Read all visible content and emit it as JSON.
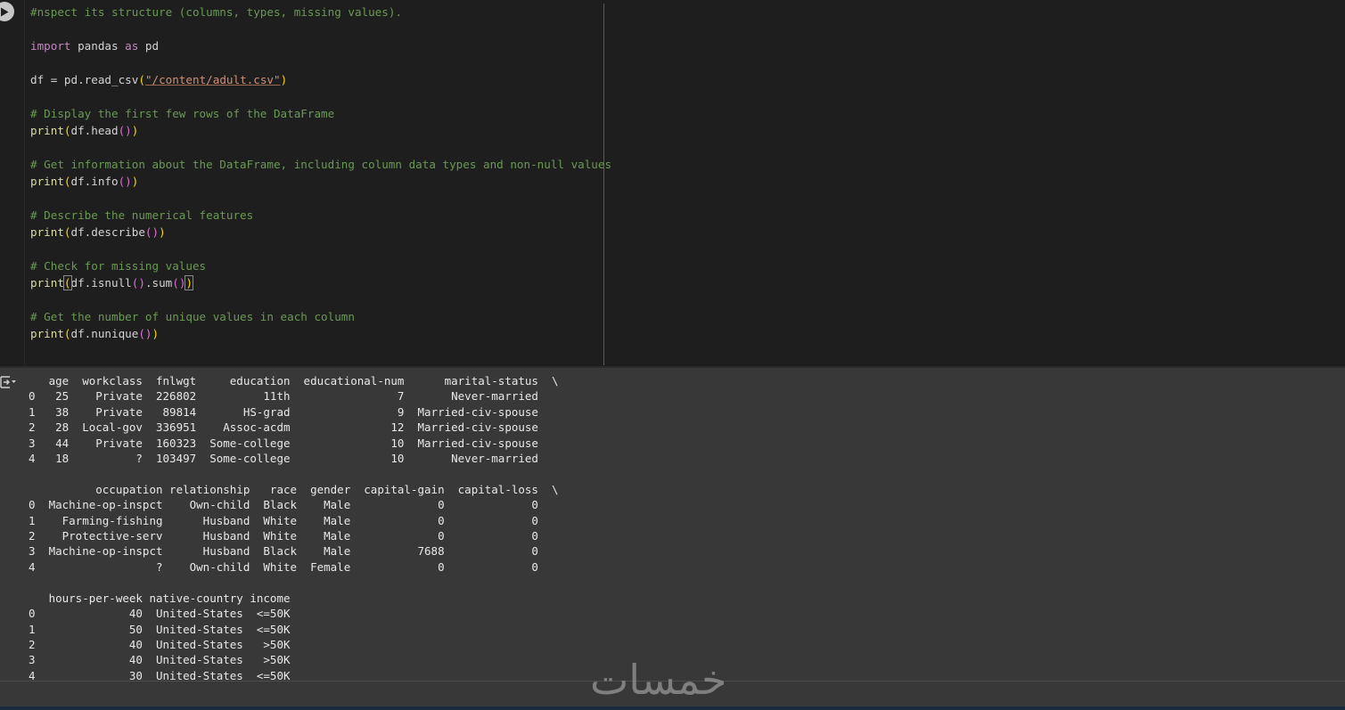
{
  "code_cell": {
    "lines": [
      [
        {
          "t": "#nspect its structure (columns, types, missing values).",
          "c": "comment"
        }
      ],
      [],
      [
        {
          "t": "import",
          "c": "keyword"
        },
        {
          "t": " pandas ",
          "c": "default"
        },
        {
          "t": "as",
          "c": "keyword"
        },
        {
          "t": " pd",
          "c": "default"
        }
      ],
      [],
      [
        {
          "t": "df = pd.",
          "c": "default"
        },
        {
          "t": "read_csv",
          "c": "default"
        },
        {
          "t": "(",
          "c": "paren-1"
        },
        {
          "t": "\"/content/adult.csv\"",
          "c": "string"
        },
        {
          "t": ")",
          "c": "paren-1"
        }
      ],
      [],
      [
        {
          "t": "# Display the first few rows of the DataFrame",
          "c": "comment"
        }
      ],
      [
        {
          "t": "print",
          "c": "func"
        },
        {
          "t": "(",
          "c": "paren-1"
        },
        {
          "t": "df.head",
          "c": "default"
        },
        {
          "t": "()",
          "c": "paren-2"
        },
        {
          "t": ")",
          "c": "paren-1"
        }
      ],
      [],
      [
        {
          "t": "# Get information about the DataFrame, including column data types and non-null values",
          "c": "comment"
        }
      ],
      [
        {
          "t": "print",
          "c": "func"
        },
        {
          "t": "(",
          "c": "paren-1"
        },
        {
          "t": "df.info",
          "c": "default"
        },
        {
          "t": "()",
          "c": "paren-2"
        },
        {
          "t": ")",
          "c": "paren-1"
        }
      ],
      [],
      [
        {
          "t": "# Describe the numerical features",
          "c": "comment"
        }
      ],
      [
        {
          "t": "print",
          "c": "func"
        },
        {
          "t": "(",
          "c": "paren-1"
        },
        {
          "t": "df.describe",
          "c": "default"
        },
        {
          "t": "()",
          "c": "paren-2"
        },
        {
          "t": ")",
          "c": "paren-1"
        }
      ],
      [],
      [
        {
          "t": "# Check for missing values",
          "c": "comment"
        }
      ],
      [
        {
          "t": "print",
          "c": "func"
        },
        {
          "t": "(",
          "c": "paren-1",
          "box": true
        },
        {
          "t": "df.isnull",
          "c": "default"
        },
        {
          "t": "()",
          "c": "paren-2"
        },
        {
          "t": ".sum",
          "c": "default"
        },
        {
          "t": "()",
          "c": "paren-2"
        },
        {
          "t": ")",
          "c": "paren-1",
          "box": true
        }
      ],
      [],
      [
        {
          "t": "# Get the number of unique values in each column",
          "c": "comment"
        }
      ],
      [
        {
          "t": "print",
          "c": "func"
        },
        {
          "t": "(",
          "c": "paren-1"
        },
        {
          "t": "df.nunique",
          "c": "default"
        },
        {
          "t": "()",
          "c": "paren-2"
        },
        {
          "t": ")",
          "c": "paren-1"
        }
      ]
    ]
  },
  "output": {
    "text": "   age  workclass  fnlwgt     education  educational-num      marital-status  \\\n0   25    Private  226802          11th                7       Never-married   \n1   38    Private   89814       HS-grad                9  Married-civ-spouse   \n2   28  Local-gov  336951    Assoc-acdm               12  Married-civ-spouse   \n3   44    Private  160323  Some-college               10  Married-civ-spouse   \n4   18          ?  103497  Some-college               10       Never-married   \n\n          occupation relationship   race  gender  capital-gain  capital-loss  \\\n0  Machine-op-inspct    Own-child  Black    Male             0             0   \n1    Farming-fishing      Husband  White    Male             0             0   \n2    Protective-serv      Husband  White    Male             0             0   \n3  Machine-op-inspct      Husband  Black    Male          7688             0   \n4                  ?    Own-child  White  Female             0             0   \n\n   hours-per-week native-country income  \n0              40  United-States  <=50K  \n1              50  United-States  <=50K  \n2              40  United-States   >50K  \n3              40  United-States   >50K  \n4              30  United-States  <=50K  "
  },
  "watermark": {
    "text": "خمسات"
  },
  "icons": {
    "run": "play-icon",
    "output_toggle": "output-toggle-icon"
  },
  "colors": {
    "editor_bg": "#1e1e1e",
    "output_bg": "#383838",
    "comment": "#6a9955",
    "keyword": "#c586c0",
    "function": "#dcdcaa",
    "string": "#ce9178"
  }
}
